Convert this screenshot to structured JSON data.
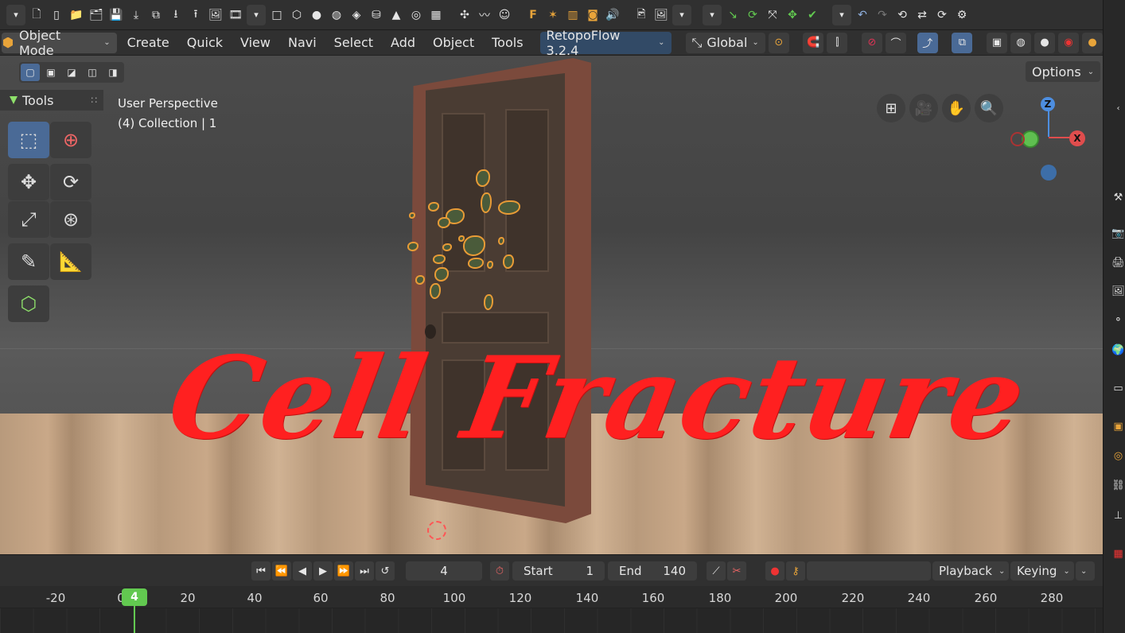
{
  "menubar": {
    "mode": "Object Mode",
    "items": [
      "Create",
      "Quick",
      "View",
      "Navi",
      "Select",
      "Add",
      "Object",
      "Tools"
    ],
    "addon": "RetopoFlow 3.2.4",
    "orientation": "Global"
  },
  "viewport": {
    "view_label": "User Perspective",
    "collection_label": "(4) Collection | 1",
    "options_label": "Options",
    "title_art": "Cell Fracture"
  },
  "tools_panel": {
    "title": "Tools"
  },
  "gizmo": {
    "z": "Z",
    "x": "X"
  },
  "timeline": {
    "current_frame": "4",
    "start_label": "Start",
    "start_value": "1",
    "end_label": "End",
    "end_value": "140",
    "playback_label": "Playback",
    "keying_label": "Keying",
    "playhead_label": "4",
    "ruler": [
      "-20",
      "0",
      "20",
      "40",
      "60",
      "80",
      "100",
      "120",
      "140",
      "160",
      "180",
      "200",
      "220",
      "240",
      "260",
      "280"
    ]
  },
  "colors": {
    "accent": "#4a6a96",
    "playhead": "#62c950",
    "title_art": "#ff2020",
    "fracture_outline": "#e89b36"
  }
}
